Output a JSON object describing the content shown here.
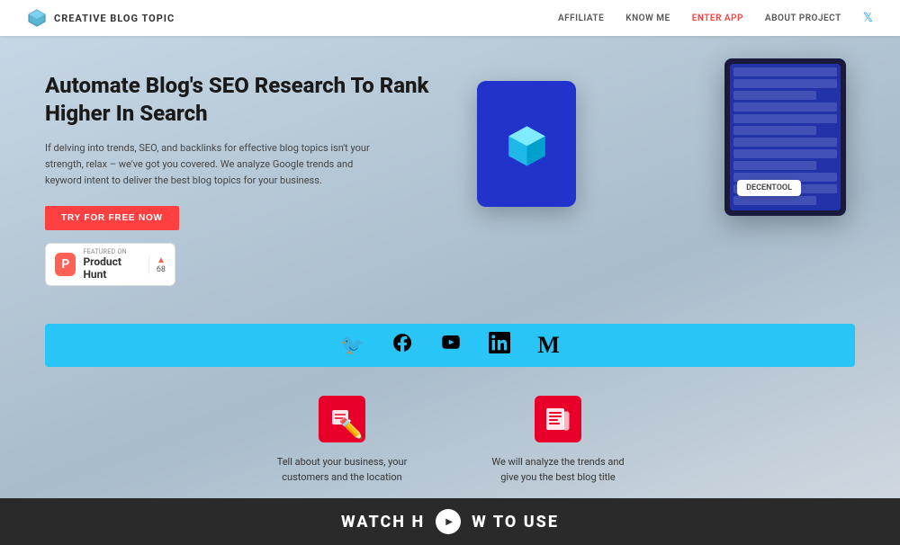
{
  "navbar": {
    "brand": "CREATIVE BLOG TOPIC",
    "links": [
      {
        "label": "AFFILIATE",
        "active": false
      },
      {
        "label": "KNOW ME",
        "active": false
      },
      {
        "label": "ENTER APP",
        "active": true
      },
      {
        "label": "ABOUT PROJECT",
        "active": false
      }
    ]
  },
  "hero": {
    "title": "Automate Blog's SEO Research To Rank Higher In Search",
    "description": "If delving into trends, SEO, and backlinks for effective blog topics isn't your strength, relax – we've got you covered. We analyze Google trends and keyword intent to deliver the best blog topics for your business.",
    "cta_button": "TRY FOR FREE NOW",
    "product_hunt": {
      "featured": "FEATURED ON",
      "name": "Product Hunt",
      "votes": "68"
    },
    "decentool_label": "DECENTOOL"
  },
  "social_bar": {
    "icons": [
      "twitter",
      "facebook",
      "youtube",
      "linkedin",
      "medium"
    ]
  },
  "features": [
    {
      "text": "Tell about your business, your customers and the location"
    },
    {
      "text": "We will analyze the trends and give you the best blog title"
    }
  ],
  "watch": {
    "title": "WATCH H",
    "title_highlight": "O",
    "title_end": "W TO USE"
  }
}
